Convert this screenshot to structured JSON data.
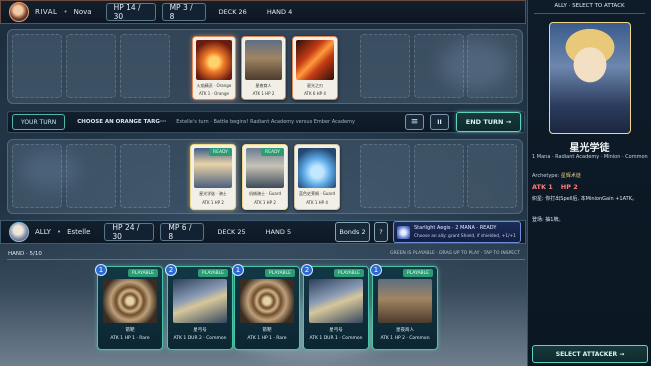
{
  "rival": {
    "name": "RIVAL",
    "sep": "•",
    "player": "Nova",
    "hp": "HP 14 / 30",
    "mp": "MP 3 / 8",
    "deck": "DECK 26",
    "hand": "HAND 4"
  },
  "enemy_cards": [
    {
      "name": "火焰精灵 · Orange",
      "stats": "ATK 1 · Orange"
    },
    {
      "name": "星夜商人",
      "stats": "ATK 1    HP 2"
    },
    {
      "name": "星光之刃",
      "stats": "ATK 6    HP 4"
    }
  ],
  "status": {
    "your_turn": "YOUR TURN",
    "instruction": "CHOOSE AN ORANGE TARG···",
    "message": "Estelle's turn  ·  Battle begins! Radiant Academy versus Ember Academy",
    "menu_icon": "≡",
    "pause_icon": "II",
    "end_turn": "END TURN →"
  },
  "ally_cards": [
    {
      "ready": "READY",
      "name": "星光学徒 · 骑士",
      "stats": "ATK 1    HP 2"
    },
    {
      "ready": "READY",
      "name": "机械骑士 · Guard",
      "stats": "ATK 1    HP 2"
    },
    {
      "ready": "",
      "name": "蓝色史莱姆 · Guard",
      "stats": "ATK 1    HP 4"
    }
  ],
  "ally": {
    "name": "ALLY",
    "sep": "•",
    "player": "Estelle",
    "hp": "HP 24 / 30",
    "mp": "MP 6 / 8",
    "deck": "DECK 25",
    "hand": "HAND 5",
    "bonds": "Bonds 2",
    "help": "?",
    "ability_title": "Starlight Aegis · 2 MANA · READY",
    "ability_desc": "Choose an ally: grant Shield, if shielded, +1/+1"
  },
  "hand": {
    "label": "HAND · 5/10",
    "hint": "GREEN IS PLAYABLE  ·  DRAG UP TO PLAY  ·  TAP TO INSPECT",
    "cards": [
      {
        "cost": "1",
        "tag": "PLAYABLE",
        "name": "箭靶",
        "stats": "ATK 1  HP 1  ·  Rare"
      },
      {
        "cost": "2",
        "tag": "PLAYABLE",
        "name": "星弓号",
        "stats": "ATK 1  DUR 2  ·  Common"
      },
      {
        "cost": "1",
        "tag": "PLAYABLE",
        "name": "箭靶",
        "stats": "ATK 1  HP 1  ·  Rare"
      },
      {
        "cost": "2",
        "tag": "PLAYABLE",
        "name": "星弓号",
        "stats": "ATK 1  DUR 1  ·  Common"
      },
      {
        "cost": "1",
        "tag": "PLAYABLE",
        "name": "星夜商人",
        "stats": "ATK 1  HP 2  ·  Common"
      }
    ]
  },
  "inspect": {
    "header": "ALLY  ·  SELECT TO ATTACK",
    "title": "星光学徒",
    "meta": "1 Mana  ·  Radiant Academy  ·  Minion  ·  Common",
    "archetype_label": "Archetype: ",
    "archetype_value": "星辉术徒",
    "atk": "ATK 1",
    "hp": "HP 2",
    "text1": "织星: 你打出Spell后, 本MinionGain +1ATK。",
    "text2": "登场: 抽1牌。",
    "button": "SELECT ATTACKER →"
  },
  "colors": {
    "accent": "#4fb8a9",
    "enemy_border": "#e08a5a",
    "ally_border": "#f0d88a",
    "playable": "#49c4a6",
    "cost": "#2a6bd3"
  }
}
